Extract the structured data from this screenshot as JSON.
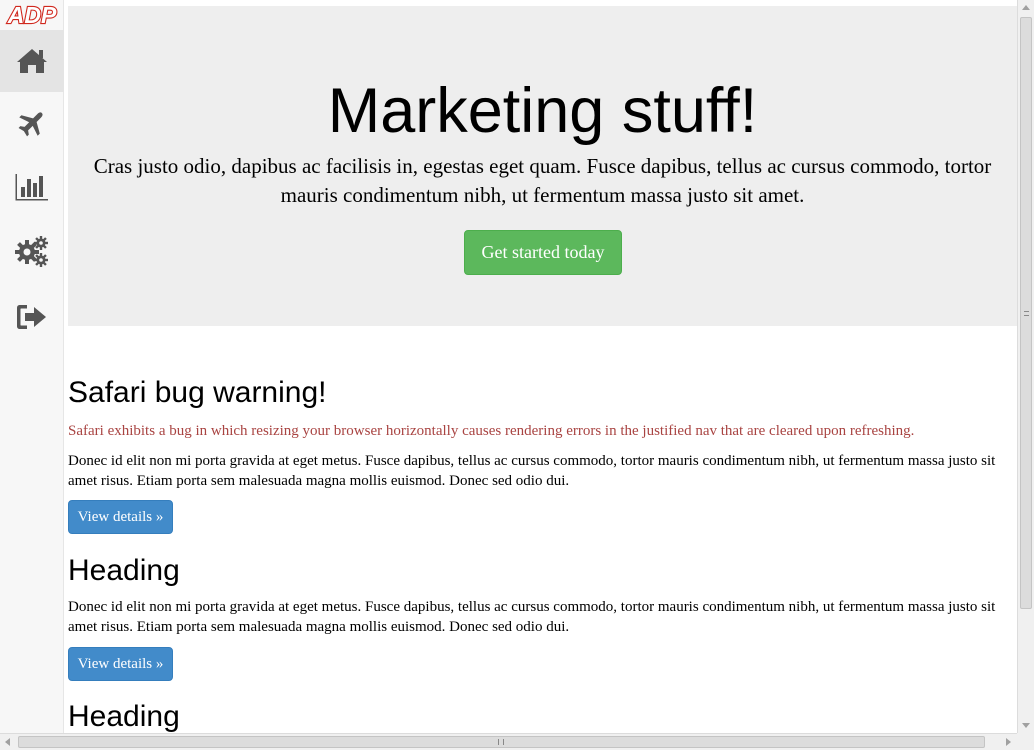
{
  "brand": {
    "logo_text": "ADP",
    "logo_color": "#d0271d"
  },
  "sidebar": {
    "items": [
      {
        "icon": "home-icon",
        "active": true
      },
      {
        "icon": "plane-icon",
        "active": false
      },
      {
        "icon": "bar-chart-icon",
        "active": false
      },
      {
        "icon": "gears-icon",
        "active": false
      },
      {
        "icon": "sign-out-icon",
        "active": false
      }
    ]
  },
  "jumbotron": {
    "title": "Marketing stuff!",
    "lead": "Cras justo odio, dapibus ac facilisis in, egestas eget quam. Fusce dapibus, tellus ac cursus commodo, tortor mauris condimentum nibh, ut fermentum massa justo sit amet.",
    "cta_label": "Get started today",
    "cta_color": "#5cb85c",
    "background": "#eeeeee"
  },
  "sections": [
    {
      "heading": "Safari bug warning!",
      "warning": "Safari exhibits a bug in which resizing your browser horizontally causes rendering errors in the justified nav that are cleared upon refreshing.",
      "body": "Donec id elit non mi porta gravida at eget metus. Fusce dapibus, tellus ac cursus commodo, tortor mauris condimentum nibh, ut fermentum massa justo sit amet risus. Etiam porta sem malesuada magna mollis euismod. Donec sed odio dui.",
      "button_label": "View details »"
    },
    {
      "heading": "Heading",
      "body": "Donec id elit non mi porta gravida at eget metus. Fusce dapibus, tellus ac cursus commodo, tortor mauris condimentum nibh, ut fermentum massa justo sit amet risus. Etiam porta sem malesuada magna mollis euismod. Donec sed odio dui.",
      "button_label": "View details »"
    },
    {
      "heading": "Heading"
    }
  ],
  "colors": {
    "primary_button": "#428bca",
    "danger_text": "#a94442",
    "icon": "#555555"
  }
}
